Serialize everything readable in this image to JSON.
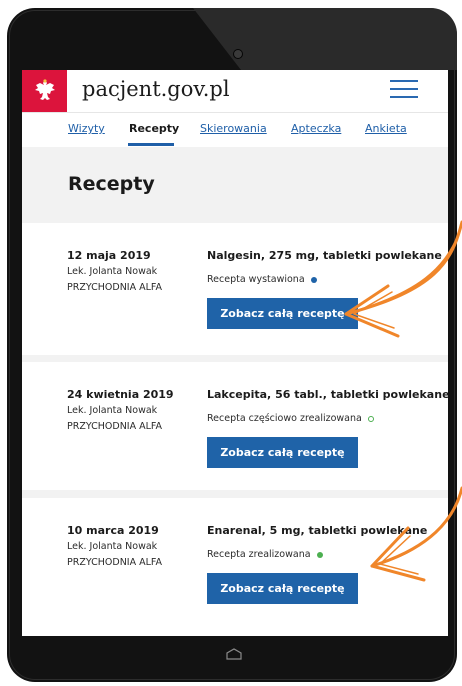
{
  "header": {
    "site_title": "pacjent.gov.pl"
  },
  "tabs": [
    {
      "label": "Wizyty"
    },
    {
      "label": "Recepty"
    },
    {
      "label": "Skierowania"
    },
    {
      "label": "Apteczka"
    },
    {
      "label": "Ankieta"
    }
  ],
  "active_tab": "Recepty",
  "page": {
    "title": "Recepty"
  },
  "prescriptions": [
    {
      "date": "12 maja 2019",
      "doctor": "Lek. Jolanta Nowak",
      "clinic": "PRZYCHODNIA ALFA",
      "drug": "Nalgesin, 275 mg, tabletki powlekane",
      "status": "Recepta wystawiona",
      "status_color": "#1f63a8",
      "button": "Zobacz całą receptę"
    },
    {
      "date": "24 kwietnia 2019",
      "doctor": "Lek. Jolanta Nowak",
      "clinic": "PRZYCHODNIA ALFA",
      "drug": "Lakcepita, 56 tabl., tabletki powlekane",
      "status": "Recepta częściowo zrealizowana",
      "status_color": "#4caf50",
      "button": "Zobacz całą receptę"
    },
    {
      "date": "10 marca 2019",
      "doctor": "Lek. Jolanta Nowak",
      "clinic": "PRZYCHODNIA ALFA",
      "drug": "Enarenal, 5 mg, tabletki powlekane",
      "status": "Recepta zrealizowana",
      "status_color": "#4caf50",
      "button": "Zobacz całą receptę"
    }
  ],
  "colors": {
    "brand_red": "#dc143c",
    "primary_blue": "#1f63a8",
    "annotation_orange": "#f0862a"
  },
  "icons": {
    "logo": "polish-eagle-emblem",
    "menu": "hamburger-menu-icon",
    "home": "home-button-icon"
  }
}
